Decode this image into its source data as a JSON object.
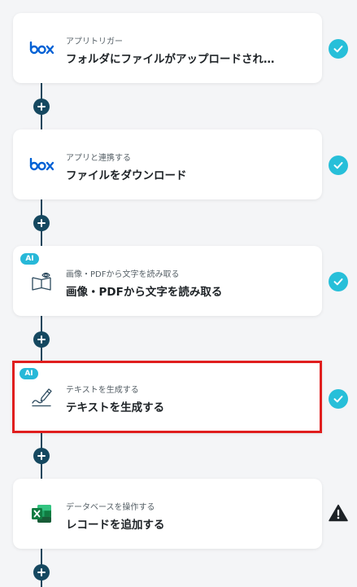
{
  "colors": {
    "accent": "#27bfd9",
    "connector": "#154860",
    "selected_border": "#e01e1e",
    "warning": "#1d2226"
  },
  "steps": [
    {
      "subtitle": "アプリトリガー",
      "title": "フォルダにファイルがアップロードされ…",
      "icon": "box-logo-icon",
      "ai": false,
      "status": "done"
    },
    {
      "subtitle": "アプリと連携する",
      "title": "ファイルをダウンロード",
      "icon": "box-logo-icon",
      "ai": false,
      "status": "done"
    },
    {
      "subtitle": "画像・PDFから文字を読み取る",
      "title": "画像・PDFから文字を読み取る",
      "icon": "book-eye-icon",
      "ai": true,
      "ai_label": "AI",
      "status": "done"
    },
    {
      "subtitle": "テキストを生成する",
      "title": "テキストを生成する",
      "icon": "pen-line-icon",
      "ai": true,
      "ai_label": "AI",
      "status": "done",
      "selected": true
    },
    {
      "subtitle": "データベースを操作する",
      "title": "レコードを追加する",
      "icon": "excel-icon",
      "ai": false,
      "status": "warning"
    }
  ]
}
